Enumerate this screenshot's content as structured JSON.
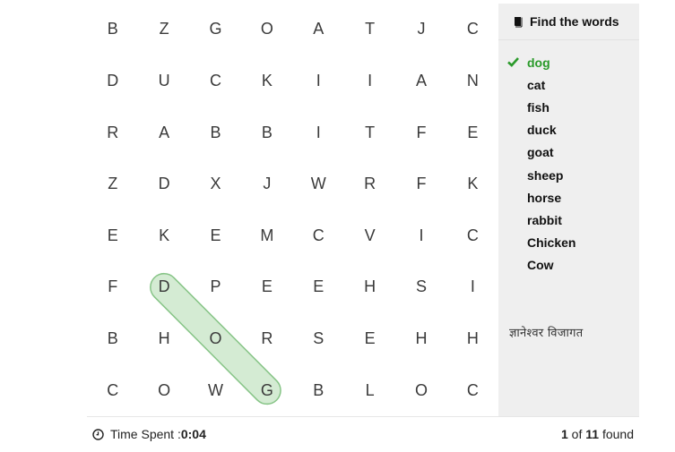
{
  "grid": {
    "rows": [
      [
        "B",
        "Z",
        "G",
        "O",
        "A",
        "T",
        "J",
        "C"
      ],
      [
        "D",
        "U",
        "C",
        "K",
        "I",
        "I",
        "A",
        "N"
      ],
      [
        "R",
        "A",
        "B",
        "B",
        "I",
        "T",
        "F",
        "E"
      ],
      [
        "Z",
        "D",
        "X",
        "J",
        "W",
        "R",
        "F",
        "K"
      ],
      [
        "E",
        "K",
        "E",
        "M",
        "C",
        "V",
        "I",
        "C"
      ],
      [
        "F",
        "D",
        "P",
        "E",
        "E",
        "H",
        "S",
        "I"
      ],
      [
        "B",
        "H",
        "O",
        "R",
        "S",
        "E",
        "H",
        "H"
      ],
      [
        "C",
        "O",
        "W",
        "G",
        "B",
        "L",
        "O",
        "C"
      ]
    ],
    "found_highlights": [
      {
        "word": "dog",
        "start": [
          5,
          1
        ],
        "end": [
          7,
          3
        ],
        "color": "#2e9e3a"
      }
    ]
  },
  "sidebar": {
    "title": "Find the words",
    "title_icon": "book-icon",
    "words": [
      {
        "label": "dog",
        "found": true
      },
      {
        "label": "cat",
        "found": false
      },
      {
        "label": "fish",
        "found": false
      },
      {
        "label": "duck",
        "found": false
      },
      {
        "label": "goat",
        "found": false
      },
      {
        "label": "sheep",
        "found": false
      },
      {
        "label": "horse",
        "found": false
      },
      {
        "label": "rabbit",
        "found": false
      },
      {
        "label": "Chicken",
        "found": false
      },
      {
        "label": "Cow",
        "found": false
      }
    ],
    "caption": "ज्ञानेश्वर विजागत"
  },
  "footer": {
    "time_label": "Time Spent : ",
    "time_value": "0:04",
    "found_num": "1",
    "found_of": " of ",
    "found_total": "11",
    "found_suffix": " found"
  },
  "colors": {
    "found_green": "#2a9a2a",
    "highlight_fill": "#d4ebd3",
    "highlight_stroke": "#86c486",
    "sidebar_bg": "#efefef"
  }
}
